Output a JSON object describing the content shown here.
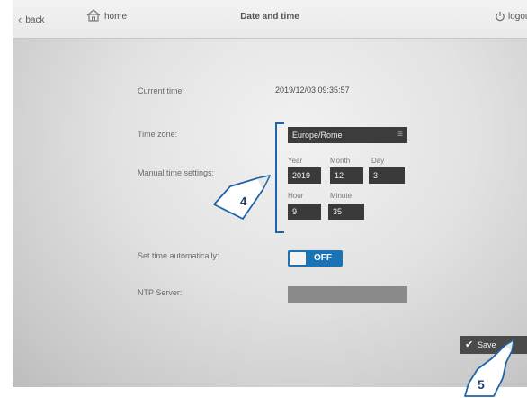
{
  "topbar": {
    "back_label": "back",
    "home_label": "home",
    "title": "Date and time",
    "logout_label": "logout"
  },
  "form": {
    "current_time_label": "Current time:",
    "current_time_value": "2019/12/03 09:35:57",
    "timezone_label": "Time zone:",
    "timezone_value": "Europe/Rome",
    "manual_label": "Manual time settings:",
    "year_label": "Year",
    "year_value": "2019",
    "month_label": "Month",
    "month_value": "12",
    "day_label": "Day",
    "day_value": "3",
    "hour_label": "Hour",
    "hour_value": "9",
    "minute_label": "Minute",
    "minute_value": "35",
    "auto_label": "Set time automatically:",
    "auto_state": "OFF",
    "ntp_label": "NTP Server:",
    "ntp_value": ""
  },
  "save_label": "Save",
  "callouts": {
    "step4": "4",
    "step5": "5"
  },
  "colors": {
    "accent": "#1a73b5",
    "bracket": "#1f64a8",
    "field_bg": "#3a3a3a"
  },
  "icons": {
    "back": "chevron-left-icon",
    "home": "home-icon",
    "logout": "power-icon",
    "save": "checkmark-icon",
    "timezone_menu": "menu-icon"
  }
}
